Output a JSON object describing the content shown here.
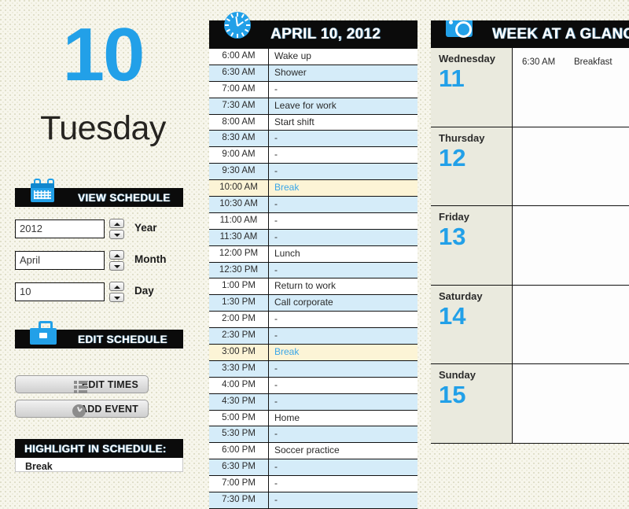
{
  "theme": {
    "accent_blue": "#22a0e8",
    "header_black": "#0b0b0b",
    "stripe_blue": "#d5ecf9",
    "highlight_cream": "#fcf4d6",
    "day_beige": "#eaeade",
    "page_bg": "#f7f6ec"
  },
  "left": {
    "date_number": "10",
    "day_name": "Tuesday",
    "view_schedule": {
      "label": "VIEW SCHEDULE",
      "icon": "calendar-icon",
      "fields": [
        {
          "value": "2012",
          "label": "Year",
          "name": "year"
        },
        {
          "value": "April",
          "label": "Month",
          "name": "month"
        },
        {
          "value": "10",
          "label": "Day",
          "name": "day"
        }
      ]
    },
    "edit_schedule": {
      "label": "EDIT SCHEDULE",
      "icon": "briefcase-icon",
      "buttons": [
        {
          "label": "EDIT TIMES",
          "icon": "list-icon"
        },
        {
          "label": "ADD EVENT",
          "icon": "clock-icon"
        }
      ]
    },
    "highlight": {
      "header": "HIGHLIGHT IN SCHEDULE:",
      "items": [
        "Break"
      ]
    }
  },
  "schedule": {
    "icon": "clock-icon",
    "title": "APRIL 10, 2012",
    "empty_marker": "-",
    "rows": [
      {
        "time": "6:00 AM",
        "event": "Wake up",
        "highlight": false
      },
      {
        "time": "6:30 AM",
        "event": "Shower",
        "highlight": false
      },
      {
        "time": "7:00 AM",
        "event": "-",
        "highlight": false
      },
      {
        "time": "7:30 AM",
        "event": "Leave for work",
        "highlight": false
      },
      {
        "time": "8:00 AM",
        "event": "Start shift",
        "highlight": false
      },
      {
        "time": "8:30 AM",
        "event": "-",
        "highlight": false
      },
      {
        "time": "9:00 AM",
        "event": "-",
        "highlight": false
      },
      {
        "time": "9:30 AM",
        "event": "-",
        "highlight": false
      },
      {
        "time": "10:00 AM",
        "event": "Break",
        "highlight": true
      },
      {
        "time": "10:30 AM",
        "event": "-",
        "highlight": false
      },
      {
        "time": "11:00 AM",
        "event": "-",
        "highlight": false
      },
      {
        "time": "11:30 AM",
        "event": "-",
        "highlight": false
      },
      {
        "time": "12:00 PM",
        "event": "Lunch",
        "highlight": false
      },
      {
        "time": "12:30 PM",
        "event": "-",
        "highlight": false
      },
      {
        "time": "1:00 PM",
        "event": "Return to work",
        "highlight": false
      },
      {
        "time": "1:30 PM",
        "event": "Call corporate",
        "highlight": false
      },
      {
        "time": "2:00 PM",
        "event": "-",
        "highlight": false
      },
      {
        "time": "2:30 PM",
        "event": "-",
        "highlight": false
      },
      {
        "time": "3:00 PM",
        "event": "Break",
        "highlight": true
      },
      {
        "time": "3:30 PM",
        "event": "-",
        "highlight": false
      },
      {
        "time": "4:00 PM",
        "event": "-",
        "highlight": false
      },
      {
        "time": "4:30 PM",
        "event": "-",
        "highlight": false
      },
      {
        "time": "5:00 PM",
        "event": "Home",
        "highlight": false
      },
      {
        "time": "5:30 PM",
        "event": "-",
        "highlight": false
      },
      {
        "time": "6:00 PM",
        "event": "Soccer practice",
        "highlight": false
      },
      {
        "time": "6:30 PM",
        "event": "-",
        "highlight": false
      },
      {
        "time": "7:00 PM",
        "event": "-",
        "highlight": false
      },
      {
        "time": "7:30 PM",
        "event": "-",
        "highlight": false
      }
    ]
  },
  "week": {
    "icon": "camera-icon",
    "title": "WEEK AT A GLANCE",
    "days": [
      {
        "name": "Wednesday",
        "number": "11",
        "events": [
          {
            "time": "6:30 AM",
            "name": "Breakfast"
          }
        ]
      },
      {
        "name": "Thursday",
        "number": "12",
        "events": []
      },
      {
        "name": "Friday",
        "number": "13",
        "events": []
      },
      {
        "name": "Saturday",
        "number": "14",
        "events": []
      },
      {
        "name": "Sunday",
        "number": "15",
        "events": []
      }
    ]
  }
}
